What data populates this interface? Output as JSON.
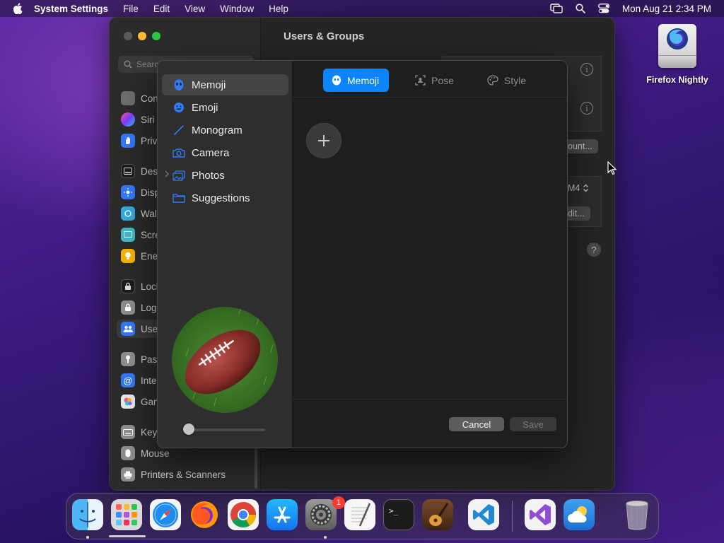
{
  "menubar": {
    "app_name": "System Settings",
    "items": [
      "File",
      "Edit",
      "View",
      "Window",
      "Help"
    ],
    "clock": "Mon Aug 21  2:34 PM"
  },
  "desktop": {
    "icon_label": "Firefox Nightly"
  },
  "settings": {
    "title": "Users & Groups",
    "search_placeholder": "Search",
    "sidebar_items": [
      {
        "label": "Control Center",
        "icon": "control-center-icon",
        "color": "#6e6e6e"
      },
      {
        "label": "Siri & Spotlight",
        "icon": "siri-icon",
        "color": "#c53cd1"
      },
      {
        "label": "Privacy & Security",
        "icon": "hand-icon",
        "color": "#3478f6"
      },
      {
        "label": "Desktop & Dock",
        "icon": "dock-icon",
        "color": "#1d1d1d"
      },
      {
        "label": "Displays",
        "icon": "sun-icon",
        "color": "#3478f6"
      },
      {
        "label": "Wallpaper",
        "icon": "wallpaper-icon",
        "color": "#35aadc"
      },
      {
        "label": "Screen Saver",
        "icon": "screensaver-icon",
        "color": "#43b8c8"
      },
      {
        "label": "Energy Saver",
        "icon": "bulb-icon",
        "color": "#f5b400"
      },
      {
        "label": "Lock Screen",
        "icon": "lock-icon",
        "color": "#1d1d1d"
      },
      {
        "label": "Login Password",
        "icon": "login-icon",
        "color": "#8e8e8e"
      },
      {
        "label": "Users & Groups",
        "icon": "users-icon",
        "color": "#3478f6"
      },
      {
        "label": "Passwords",
        "icon": "key-icon",
        "color": "#8e8e8e"
      },
      {
        "label": "Internet Accounts",
        "icon": "at-icon",
        "color": "#3478f6"
      },
      {
        "label": "Game Center",
        "icon": "game-center-icon",
        "color": "#e9e9e9"
      },
      {
        "label": "Keyboard",
        "icon": "keyboard-icon",
        "color": "#8e8e8e"
      },
      {
        "label": "Mouse",
        "icon": "mouse-icon",
        "color": "#8e8e8e"
      },
      {
        "label": "Printers & Scanners",
        "icon": "printer-icon",
        "color": "#8e8e8e"
      }
    ],
    "bg_account_button": "ount...",
    "bg_edit_button": "dit...",
    "bg_stepper_text": "M4"
  },
  "dialog": {
    "sources": [
      {
        "label": "Memoji",
        "icon": "memoji-icon"
      },
      {
        "label": "Emoji",
        "icon": "emoji-icon"
      },
      {
        "label": "Monogram",
        "icon": "monogram-icon"
      },
      {
        "label": "Camera",
        "icon": "camera-icon"
      },
      {
        "label": "Photos",
        "icon": "photos-icon"
      },
      {
        "label": "Suggestions",
        "icon": "folder-icon"
      }
    ],
    "selected_source": "Memoji",
    "tabs": [
      "Memoji",
      "Pose",
      "Style"
    ],
    "active_tab": "Memoji",
    "cancel_label": "Cancel",
    "save_label": "Save",
    "zoom_level": 0
  },
  "dock": {
    "apps": [
      "Finder",
      "Launchpad",
      "Safari",
      "Firefox",
      "Chrome",
      "App Store",
      "System Settings",
      "TextEdit",
      "Terminal",
      "GarageBand",
      "Visual Studio Code",
      "Visual Studio",
      "Weather",
      "Trash"
    ],
    "settings_badge": "1"
  },
  "colors": {
    "accent": "#0a84ff"
  }
}
